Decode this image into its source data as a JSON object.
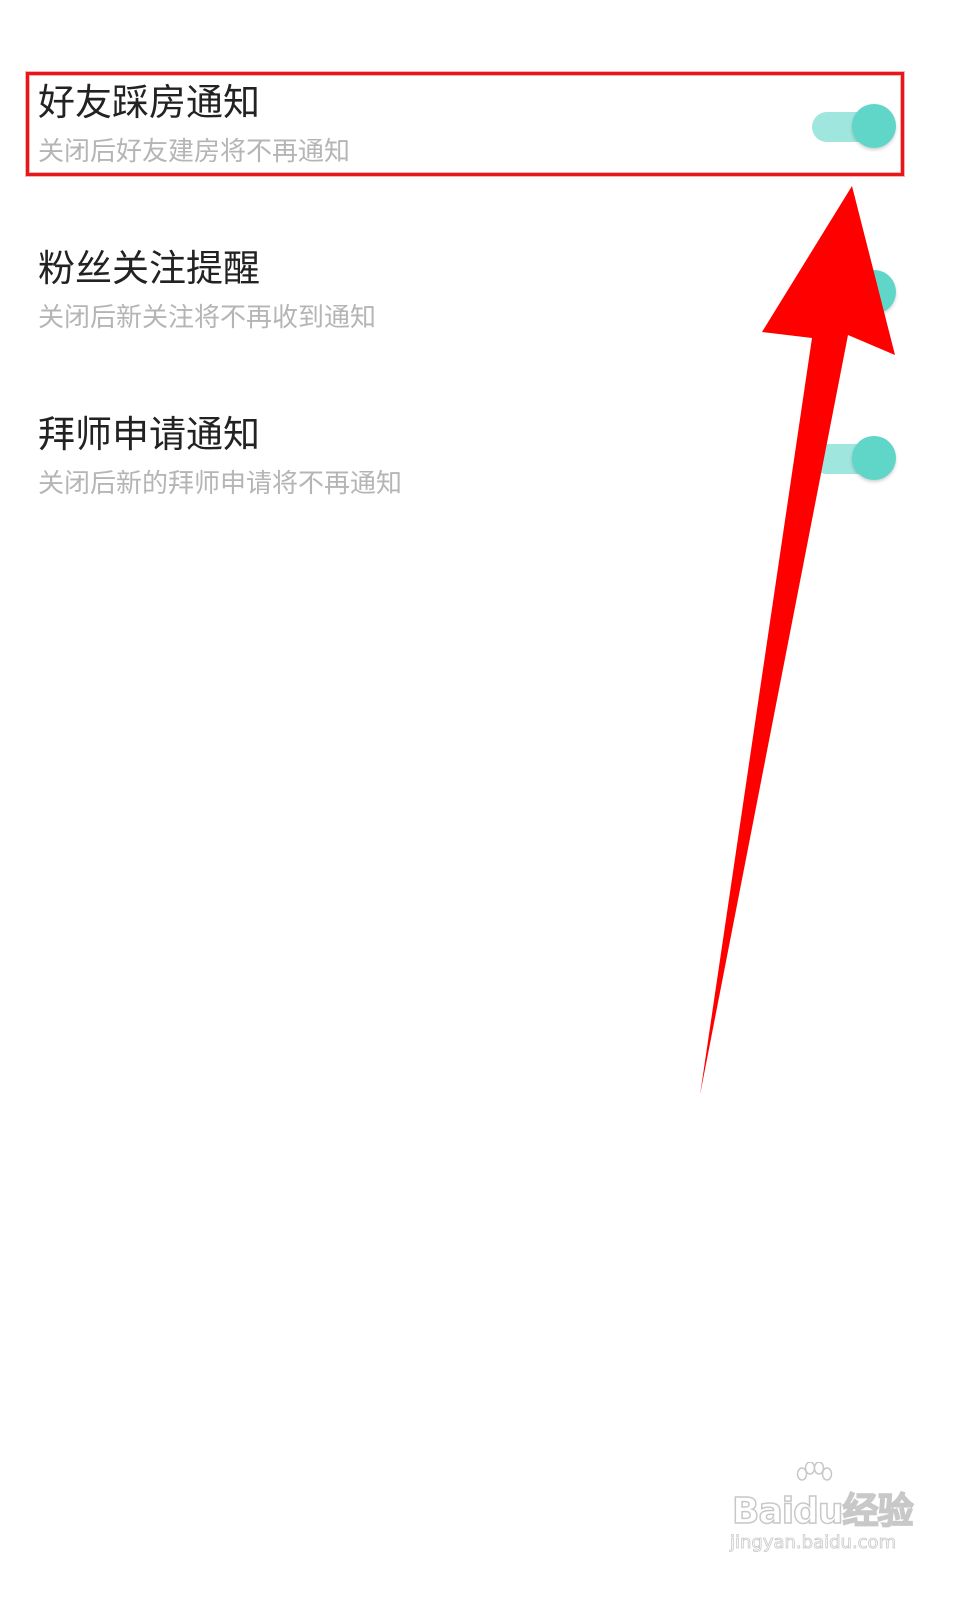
{
  "settings": [
    {
      "title": "好友踩房通知",
      "description": "关闭后好友建房将不再通知",
      "enabled": true
    },
    {
      "title": "粉丝关注提醒",
      "description": "关闭后新关注将不再收到通知",
      "enabled": true
    },
    {
      "title": "拜师申请通知",
      "description": "关闭后新的拜师申请将不再通知",
      "enabled": true
    }
  ],
  "colors": {
    "toggle_knob": "#5fd6c8",
    "toggle_track": "#9fe6de",
    "highlight": "#e8161a",
    "arrow": "#ff0000"
  },
  "watermark": {
    "brand": "Baidu经验",
    "url": "jingyan.baidu.com"
  }
}
